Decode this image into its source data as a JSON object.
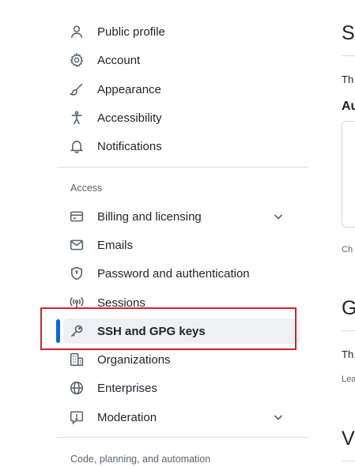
{
  "nav": {
    "items": [
      {
        "label": "Public profile",
        "icon": "person-icon"
      },
      {
        "label": "Account",
        "icon": "gear-icon"
      },
      {
        "label": "Appearance",
        "icon": "paintbrush-icon"
      },
      {
        "label": "Accessibility",
        "icon": "accessibility-icon"
      },
      {
        "label": "Notifications",
        "icon": "bell-icon"
      }
    ],
    "access_heading": "Access",
    "access_items": [
      {
        "label": "Billing and licensing",
        "icon": "credit-card-icon",
        "expandable": true
      },
      {
        "label": "Emails",
        "icon": "mail-icon"
      },
      {
        "label": "Password and authentication",
        "icon": "shield-lock-icon"
      },
      {
        "label": "Sessions",
        "icon": "broadcast-icon"
      },
      {
        "label": "SSH and GPG keys",
        "icon": "key-icon",
        "active": true
      },
      {
        "label": "Organizations",
        "icon": "organization-icon"
      },
      {
        "label": "Enterprises",
        "icon": "globe-icon"
      },
      {
        "label": "Moderation",
        "icon": "report-icon",
        "expandable": true
      }
    ],
    "code_heading": "Code, planning, and automation"
  },
  "right_panel": {
    "title1": "SS",
    "text1": "Th",
    "subheading": "Au",
    "text2": "Ch",
    "title2": "G",
    "text3": "Th",
    "text4": "Lea",
    "title3": "V"
  },
  "colors": {
    "accent": "#0969da",
    "highlight": "#d1242f",
    "active_bg": "#eef0f3"
  }
}
